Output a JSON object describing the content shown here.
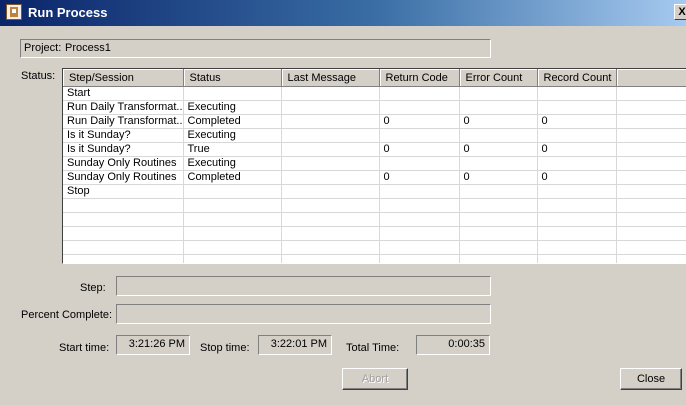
{
  "window": {
    "title": "Run Process",
    "close_glyph": "X",
    "icon": "process-icon"
  },
  "project": {
    "label": "Project:",
    "value": "Process1"
  },
  "status": {
    "label": "Status:",
    "columns": [
      "Step/Session",
      "Status",
      "Last Message",
      "Return Code",
      "Error Count",
      "Record Count",
      ""
    ],
    "rows": [
      [
        "Start",
        "",
        "",
        "",
        "",
        "",
        ""
      ],
      [
        "Run Daily Transformat...",
        "Executing",
        "",
        "",
        "",
        "",
        ""
      ],
      [
        "Run Daily Transformat...",
        "Completed",
        "",
        "0",
        "0",
        "0",
        ""
      ],
      [
        "Is it Sunday?",
        "Executing",
        "",
        "",
        "",
        "",
        ""
      ],
      [
        "Is it Sunday?",
        "True",
        "",
        "0",
        "0",
        "0",
        ""
      ],
      [
        "Sunday Only Routines",
        "Executing",
        "",
        "",
        "",
        "",
        ""
      ],
      [
        "Sunday Only Routines",
        "Completed",
        "",
        "0",
        "0",
        "0",
        ""
      ],
      [
        "Stop",
        "",
        "",
        "",
        "",
        "",
        ""
      ],
      [
        "",
        "",
        "",
        "",
        "",
        "",
        ""
      ],
      [
        "",
        "",
        "",
        "",
        "",
        "",
        ""
      ],
      [
        "",
        "",
        "",
        "",
        "",
        "",
        ""
      ],
      [
        "",
        "",
        "",
        "",
        "",
        "",
        ""
      ],
      [
        "",
        "",
        "",
        "",
        "",
        "",
        ""
      ]
    ]
  },
  "step": {
    "label": "Step:",
    "value": ""
  },
  "percent": {
    "label": "Percent Complete:",
    "value": ""
  },
  "times": {
    "start_label": "Start time:",
    "start_value": "3:21:26 PM",
    "stop_label": "Stop time:",
    "stop_value": "3:22:01 PM",
    "total_label": "Total Time:",
    "total_value": "0:00:35"
  },
  "buttons": {
    "abort": "Abort",
    "close": "Close"
  }
}
